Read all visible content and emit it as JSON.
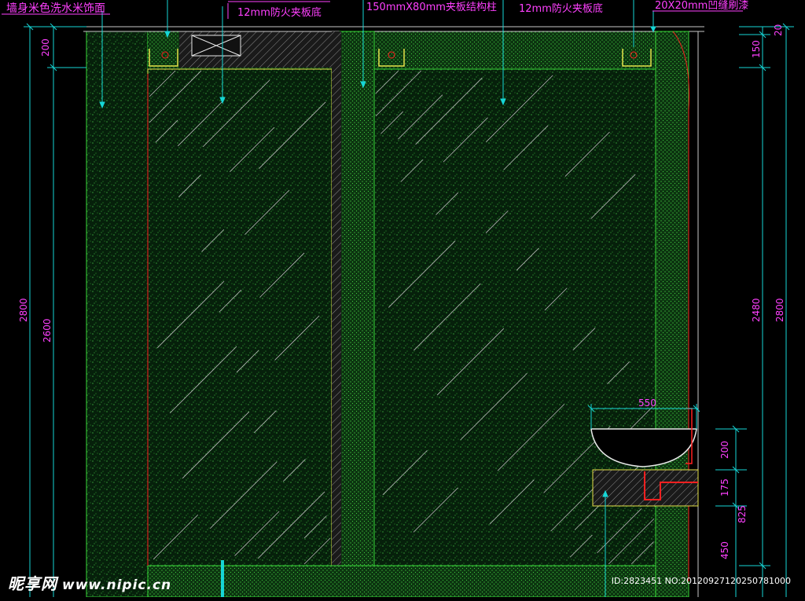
{
  "colors": {
    "background": "#000000",
    "wall_fill": "#0b2a10",
    "dots": "#4fe04f",
    "outline_green": "#37d637",
    "outline_yellow": "#e6e24a",
    "glass_line": "#b9b9b9",
    "dim_line": "#16d6d6",
    "label_magenta": "#ff40ff",
    "red": "#ff2020",
    "white": "#ffffff"
  },
  "labels": {
    "wall_finish": "墙身米色洗水米饰面",
    "fireboard_left": "12mm防火夹板底",
    "column": "150mmX80mm夹板结构柱",
    "fireboard_right": "12mm防火夹板底",
    "groove": "20X20mm凹缝刷漆"
  },
  "dimensions": {
    "left_outer": "2800",
    "left_inner": "2600",
    "left_top": "200",
    "right_top_20": "20",
    "right_top_150": "150",
    "right_main": "2480",
    "right_outer": "2800",
    "basin_width": "550",
    "basin_200": "200",
    "basin_175": "175",
    "basin_825": "825",
    "basin_450": "450"
  },
  "watermark": {
    "brand": "昵享网",
    "url": "www.nipic.cn",
    "id_text": "ID:2823451 NO:20120927120250781000"
  }
}
